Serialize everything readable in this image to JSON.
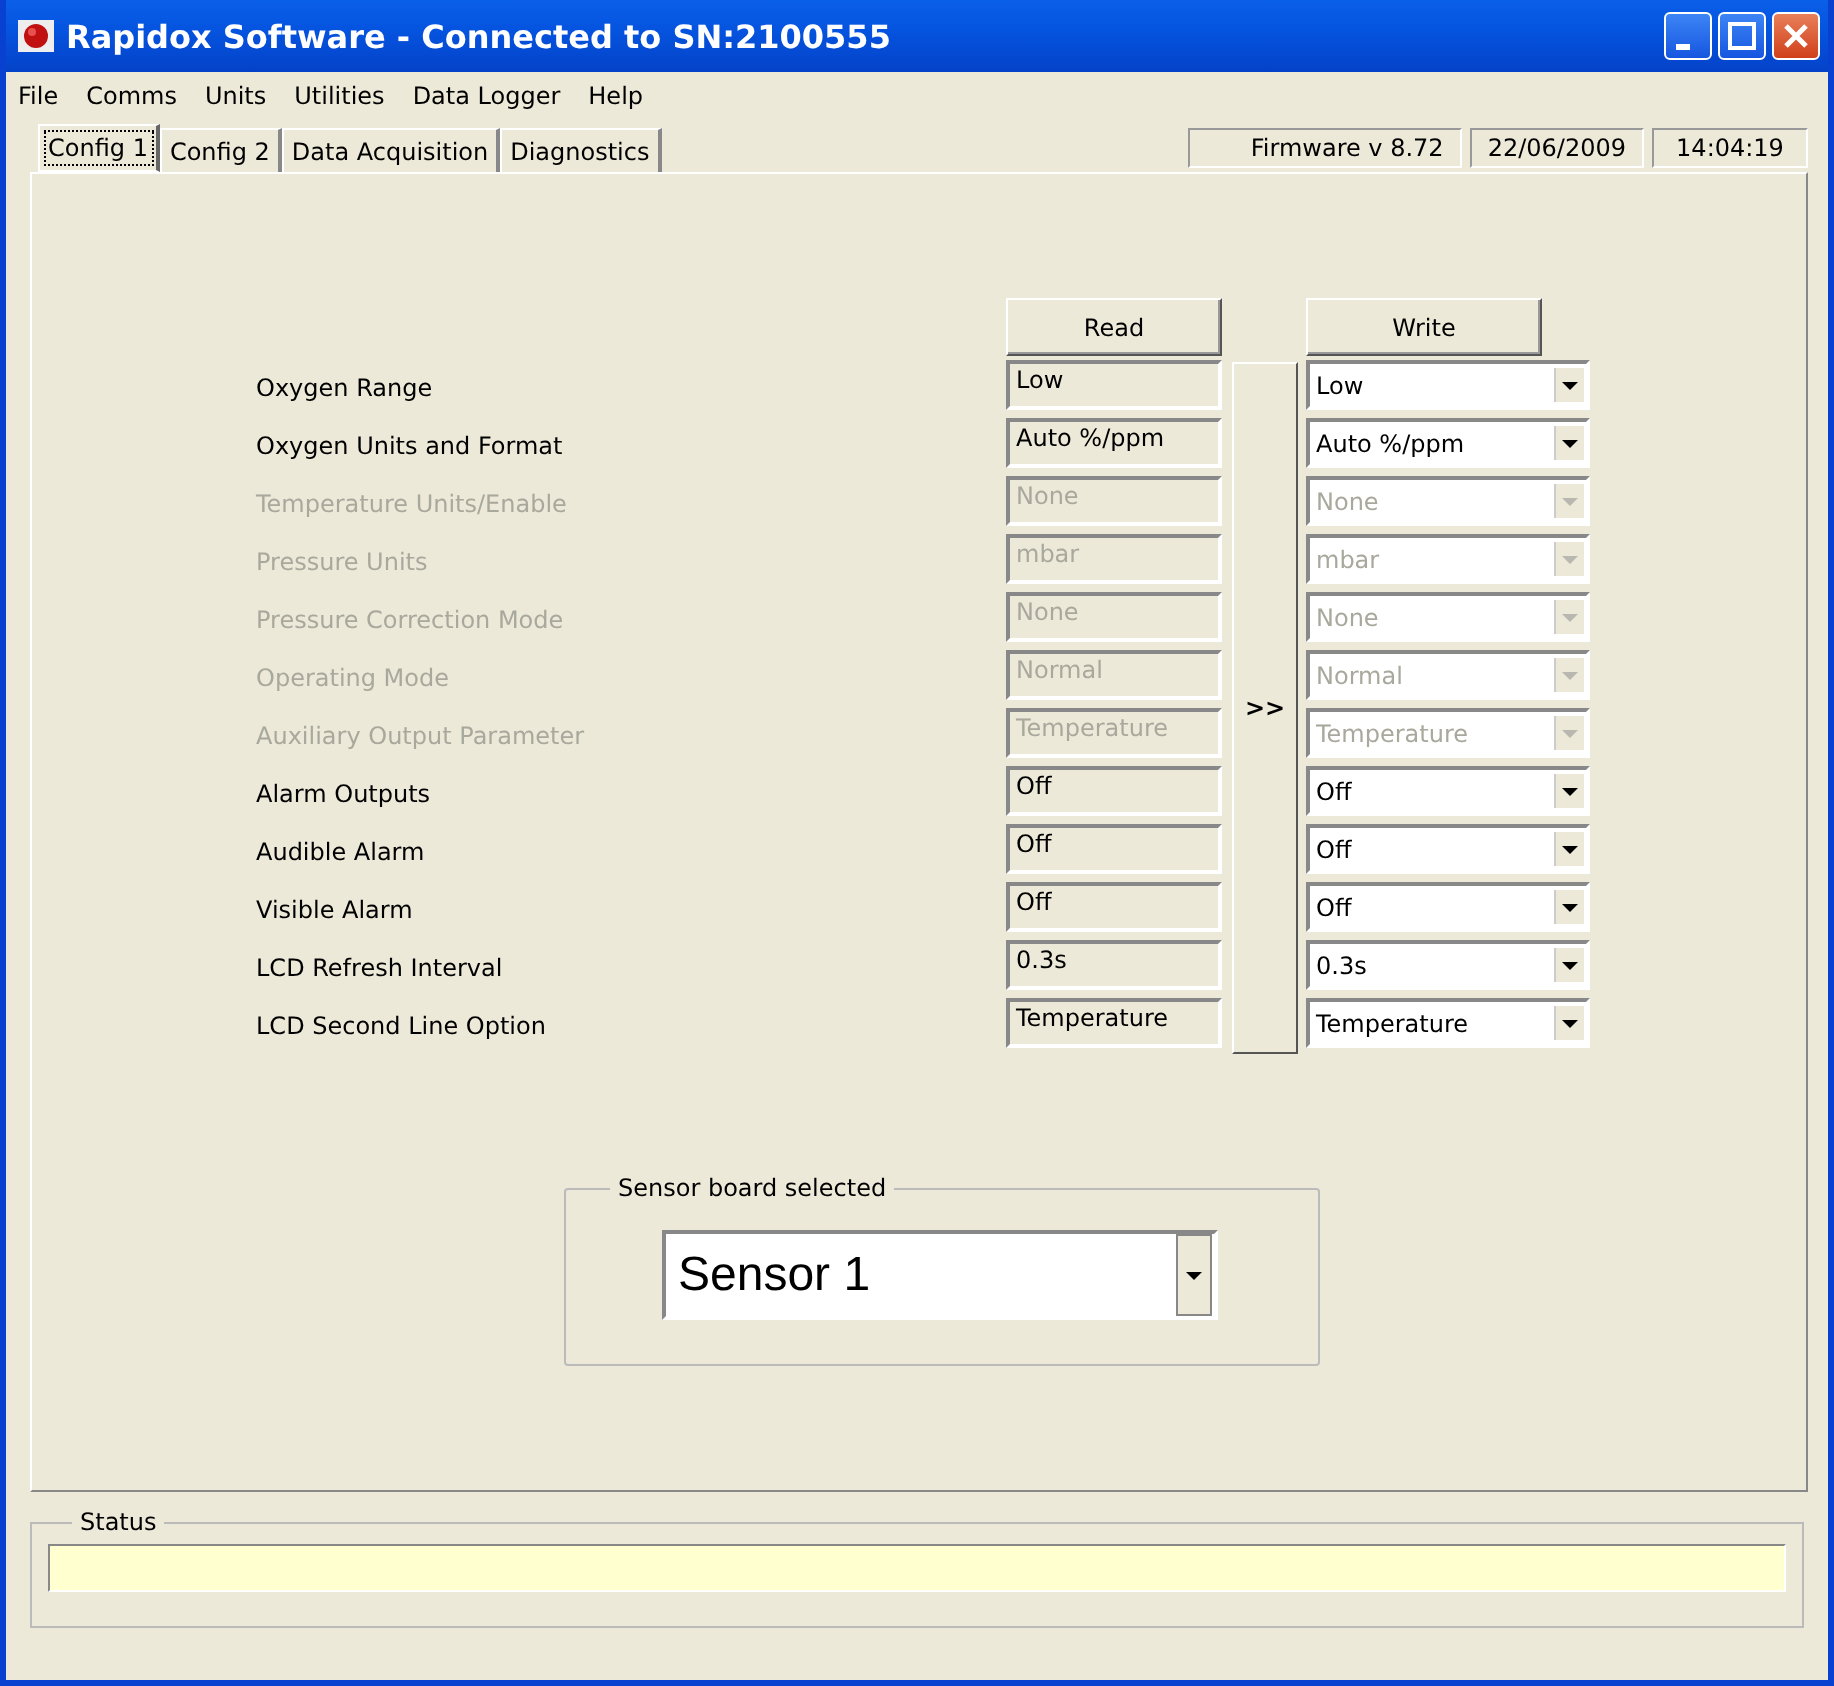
{
  "window": {
    "title": "Rapidox Software - Connected to SN:2100555"
  },
  "menu": [
    "File",
    "Comms",
    "Units",
    "Utilities",
    "Data Logger",
    "Help"
  ],
  "tabs": [
    {
      "label": "Config 1",
      "selected": true
    },
    {
      "label": "Config 2",
      "selected": false
    },
    {
      "label": "Data Acquisition",
      "selected": false
    },
    {
      "label": "Diagnostics",
      "selected": false
    }
  ],
  "info_panels": [
    "Firmware v 8.72",
    "22/06/2009",
    "14:04:19"
  ],
  "read_button": "Read",
  "write_button": "Write",
  "transfer_button": ">>",
  "settings": [
    {
      "label": "Oxygen Range",
      "read": "Low",
      "write": "Low",
      "disabled": false
    },
    {
      "label": "Oxygen Units and Format",
      "read": "Auto %/ppm",
      "write": "Auto %/ppm",
      "disabled": false
    },
    {
      "label": "Temperature Units/Enable",
      "read": "None",
      "write": "None",
      "disabled": true
    },
    {
      "label": "Pressure Units",
      "read": "mbar",
      "write": "mbar",
      "disabled": true
    },
    {
      "label": "Pressure Correction Mode",
      "read": "None",
      "write": "None",
      "disabled": true
    },
    {
      "label": "Operating Mode",
      "read": "Normal",
      "write": "Normal",
      "disabled": true
    },
    {
      "label": "Auxiliary Output Parameter",
      "read": "Temperature",
      "write": "Temperature",
      "disabled": true
    },
    {
      "label": "Alarm Outputs",
      "read": "Off",
      "write": "Off",
      "disabled": false
    },
    {
      "label": "Audible Alarm",
      "read": "Off",
      "write": "Off",
      "disabled": false
    },
    {
      "label": "Visible Alarm",
      "read": "Off",
      "write": "Off",
      "disabled": false
    },
    {
      "label": "LCD Refresh Interval",
      "read": "0.3s",
      "write": "0.3s",
      "disabled": false
    },
    {
      "label": "LCD Second Line Option",
      "read": "Temperature",
      "write": "Temperature",
      "disabled": false
    }
  ],
  "sensor_group": {
    "title": "Sensor board selected",
    "value": "Sensor 1"
  },
  "status": {
    "title": "Status"
  }
}
